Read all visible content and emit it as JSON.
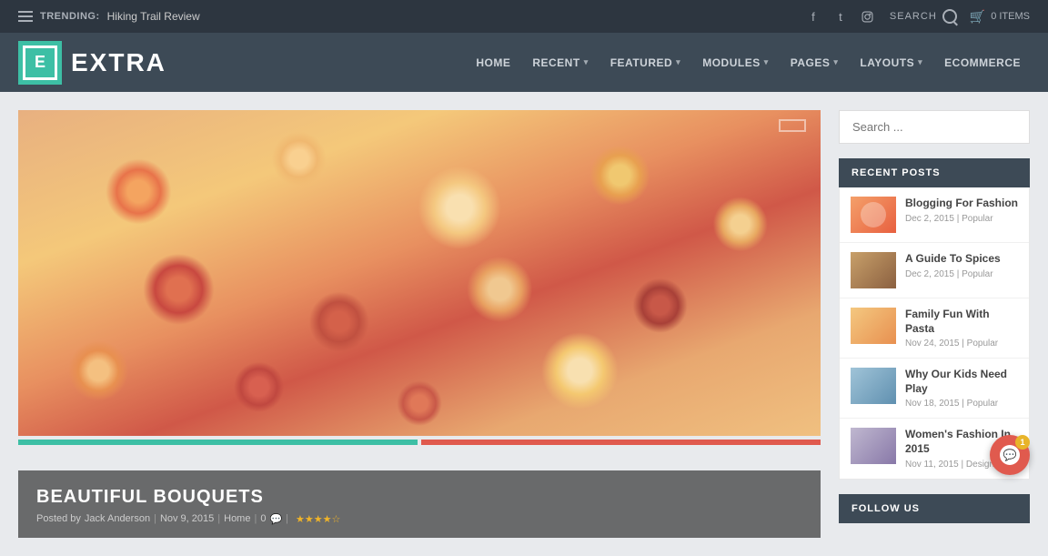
{
  "topbar": {
    "trending_label": "TRENDING:",
    "trending_text": "Hiking Trail Review",
    "search_label": "SEARCH",
    "cart_items": "0 ITEMS"
  },
  "nav": {
    "logo_letter": "E",
    "logo_text": "EXTRA",
    "links": [
      {
        "label": "HOME",
        "has_dropdown": false
      },
      {
        "label": "RECENT",
        "has_dropdown": true
      },
      {
        "label": "FEATURED",
        "has_dropdown": true
      },
      {
        "label": "MODULES",
        "has_dropdown": true
      },
      {
        "label": "PAGES",
        "has_dropdown": true
      },
      {
        "label": "LAYOUTS",
        "has_dropdown": true
      },
      {
        "label": "ECOMMERCE",
        "has_dropdown": false
      }
    ]
  },
  "featured": {
    "title": "BEAUTIFUL BOUQUETS",
    "meta_prefix": "Posted by",
    "author": "Jack Anderson",
    "date": "Nov 9, 2015",
    "category": "Home",
    "comments": "0",
    "rating": "★★★★☆"
  },
  "sidebar": {
    "search_placeholder": "Search ...",
    "recent_posts_title": "RECENT POSTS",
    "posts": [
      {
        "title": "Blogging For Fashion",
        "date": "Dec 2, 2015",
        "tag": "Popular",
        "thumb_class": "thumb-fashion"
      },
      {
        "title": "A Guide To Spices",
        "date": "Dec 2, 2015",
        "tag": "Popular",
        "thumb_class": "thumb-spices"
      },
      {
        "title": "Family Fun With Pasta",
        "date": "Nov 24, 2015",
        "tag": "Popular",
        "thumb_class": "thumb-pasta"
      },
      {
        "title": "Why Our Kids Need Play",
        "date": "Nov 18, 2015",
        "tag": "Popular",
        "thumb_class": "thumb-kids"
      },
      {
        "title": "Women's Fashion In 2015",
        "date": "Nov 11, 2015",
        "tag": "Design",
        "thumb_class": "thumb-womens"
      }
    ],
    "follow_title": "FOLLOW US"
  },
  "chat": {
    "badge": "1"
  }
}
